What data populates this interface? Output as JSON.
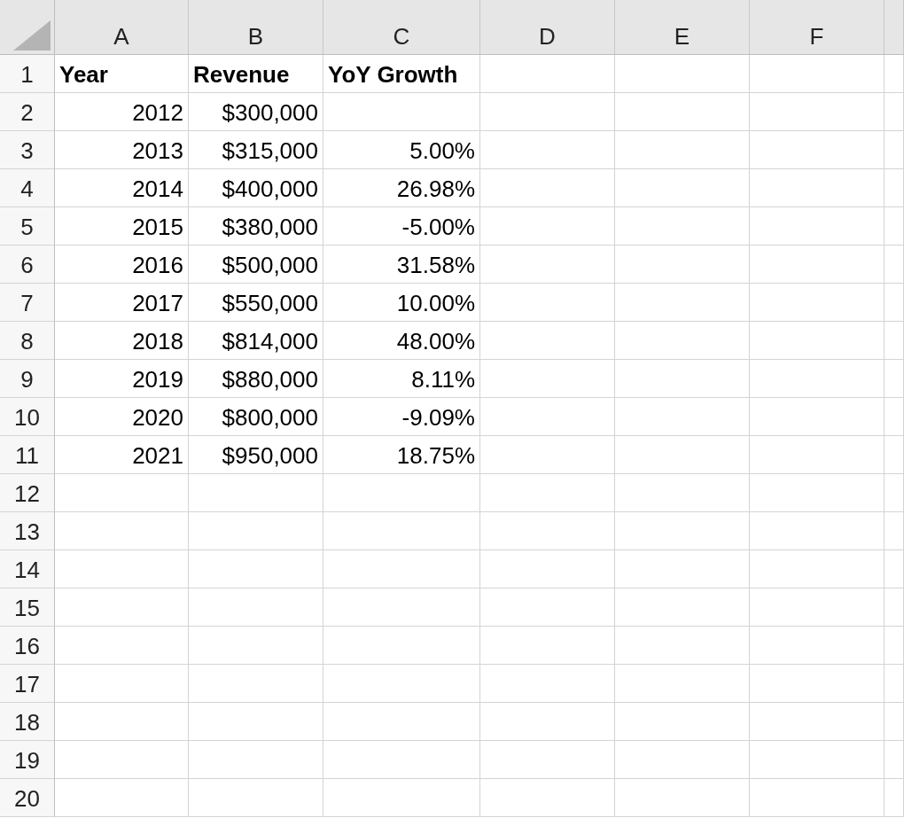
{
  "columns": [
    "A",
    "B",
    "C",
    "D",
    "E",
    "F"
  ],
  "rows": [
    {
      "number": "1",
      "kind": "header",
      "cells": [
        "Year",
        "Revenue",
        "YoY Growth"
      ]
    },
    {
      "number": "2",
      "kind": "data",
      "cells": [
        "2012",
        "$300,000"
      ]
    },
    {
      "number": "3",
      "kind": "data",
      "cells": [
        "2013",
        "$315,000",
        "5.00%"
      ]
    },
    {
      "number": "4",
      "kind": "data",
      "cells": [
        "2014",
        "$400,000",
        "26.98%"
      ]
    },
    {
      "number": "5",
      "kind": "data",
      "cells": [
        "2015",
        "$380,000",
        "-5.00%"
      ]
    },
    {
      "number": "6",
      "kind": "data",
      "cells": [
        "2016",
        "$500,000",
        "31.58%"
      ]
    },
    {
      "number": "7",
      "kind": "data",
      "cells": [
        "2017",
        "$550,000",
        "10.00%"
      ]
    },
    {
      "number": "8",
      "kind": "data",
      "cells": [
        "2018",
        "$814,000",
        "48.00%"
      ]
    },
    {
      "number": "9",
      "kind": "data",
      "cells": [
        "2019",
        "$880,000",
        "8.11%"
      ]
    },
    {
      "number": "10",
      "kind": "data",
      "cells": [
        "2020",
        "$800,000",
        "-9.09%"
      ]
    },
    {
      "number": "11",
      "kind": "data",
      "cells": [
        "2021",
        "$950,000",
        "18.75%"
      ]
    },
    {
      "number": "12"
    },
    {
      "number": "13"
    },
    {
      "number": "14"
    },
    {
      "number": "15"
    },
    {
      "number": "16"
    },
    {
      "number": "17"
    },
    {
      "number": "18"
    },
    {
      "number": "19"
    },
    {
      "number": "20"
    }
  ]
}
